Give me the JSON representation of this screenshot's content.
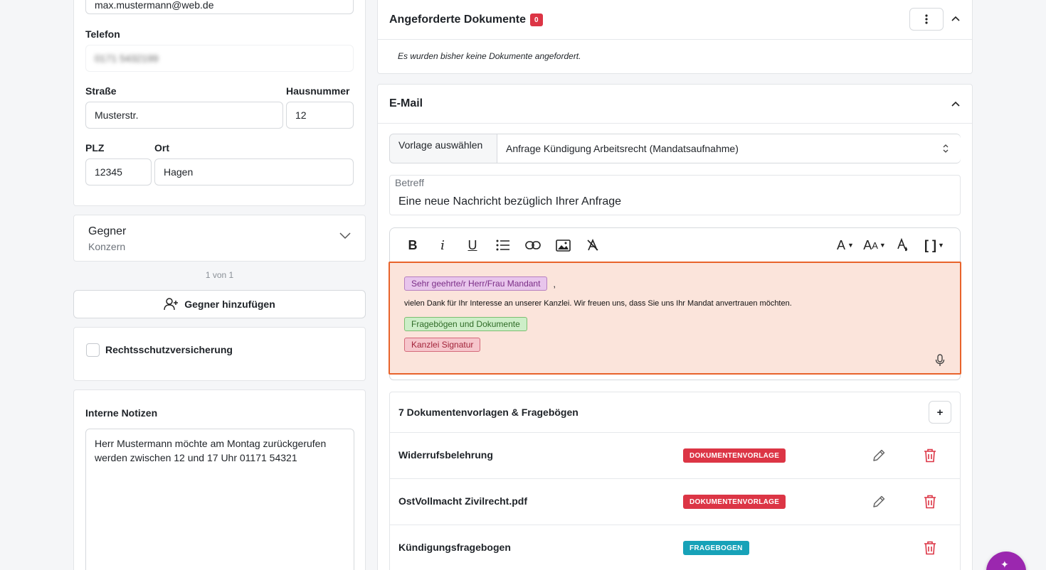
{
  "left": {
    "email_value": "max.mustermann@web.de",
    "telefon_label": "Telefon",
    "telefon_value": "0171 5432199",
    "strasse_label": "Straße",
    "strasse_value": "Musterstr.",
    "hausnummer_label": "Hausnummer",
    "hausnummer_value": "12",
    "plz_label": "PLZ",
    "plz_value": "12345",
    "ort_label": "Ort",
    "ort_value": "Hagen",
    "gegner_title": "Gegner",
    "gegner_subtitle": "Konzern",
    "pagination": "1 von 1",
    "add_gegner_label": "Gegner hinzufügen",
    "rechtsschutz_label": "Rechtsschutzversicherung",
    "notizen_label": "Interne Notizen",
    "notizen_value": "Herr Mustermann möchte am Montag zurückgerufen werden zwischen 12 und 17 Uhr 01171 54321"
  },
  "angefordert": {
    "title": "Angeforderte Dokumente",
    "count": "0",
    "empty_text": "Es wurden bisher keine Dokumente angefordert."
  },
  "email": {
    "title": "E-Mail",
    "vorlage_label": "Vorlage auswählen",
    "vorlage_value": "Anfrage Kündigung Arbeitsrecht (Mandatsaufnahme)",
    "betreff_label": "Betreff",
    "betreff_value": "Eine neue Nachricht bezüglich Ihrer Anfrage",
    "chip_salutation": "Sehr geehrte/r Herr/Frau Mandant",
    "comma": ",",
    "body_text": "vielen Dank für Ihr Interesse an unserer Kanzlei. Wir freuen uns, dass Sie uns Ihr Mandat anvertrauen möchten.",
    "chip_docs": "Fragebögen und Dokumente",
    "chip_signature": "Kanzlei Signatur"
  },
  "templates": {
    "header": "7 Dokumentenvorlagen & Fragebögen",
    "add_symbol": "+",
    "rows": [
      {
        "name": "Widerrufsbelehrung",
        "badge": "DOKUMENTENVORLAGE"
      },
      {
        "name": "OstVollmacht Zivilrecht.pdf",
        "badge": "DOKUMENTENVORLAGE"
      },
      {
        "name": "Kündigungsfragebogen",
        "badge": "FRAGEBOGEN"
      }
    ]
  },
  "colors": {
    "accent_red": "#dc3545",
    "teal": "#17a2b8",
    "editor_bg": "#fbe4db",
    "editor_border": "#e8632b",
    "fab": "#9b27af"
  }
}
